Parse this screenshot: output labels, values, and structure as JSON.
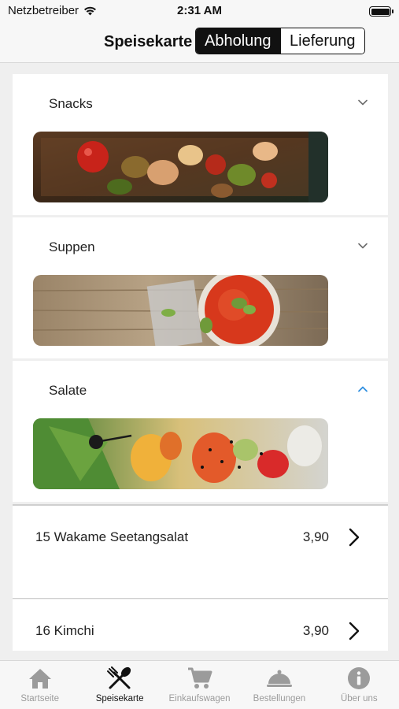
{
  "status_bar": {
    "carrier": "Netzbetreiber",
    "time": "2:31 AM"
  },
  "nav": {
    "title": "Speisekarte",
    "segments": [
      {
        "label": "Abholung",
        "selected": true
      },
      {
        "label": "Lieferung",
        "selected": false
      }
    ]
  },
  "categories": [
    {
      "label": "Snacks",
      "expanded": false,
      "image": "grilled-skewers-photo"
    },
    {
      "label": "Suppen",
      "expanded": false,
      "image": "tomato-soup-photo"
    },
    {
      "label": "Salate",
      "expanded": true,
      "image": "salad-photo"
    }
  ],
  "items": [
    {
      "name": "15 Wakame Seetangsalat",
      "price": "3,90"
    },
    {
      "name": "16 Kimchi",
      "price": "3,90"
    }
  ],
  "tabs": [
    {
      "label": "Startseite",
      "icon": "home-icon",
      "active": false
    },
    {
      "label": "Speisekarte",
      "icon": "utensils-icon",
      "active": true
    },
    {
      "label": "Einkaufswagen",
      "icon": "cart-icon",
      "active": false
    },
    {
      "label": "Bestellungen",
      "icon": "cloche-icon",
      "active": false
    },
    {
      "label": "Über uns",
      "icon": "info-icon",
      "active": false
    }
  ],
  "colors": {
    "accent": "#2f8fe0",
    "active_tab": "#111111",
    "inactive_tab": "#9b9b9b"
  }
}
